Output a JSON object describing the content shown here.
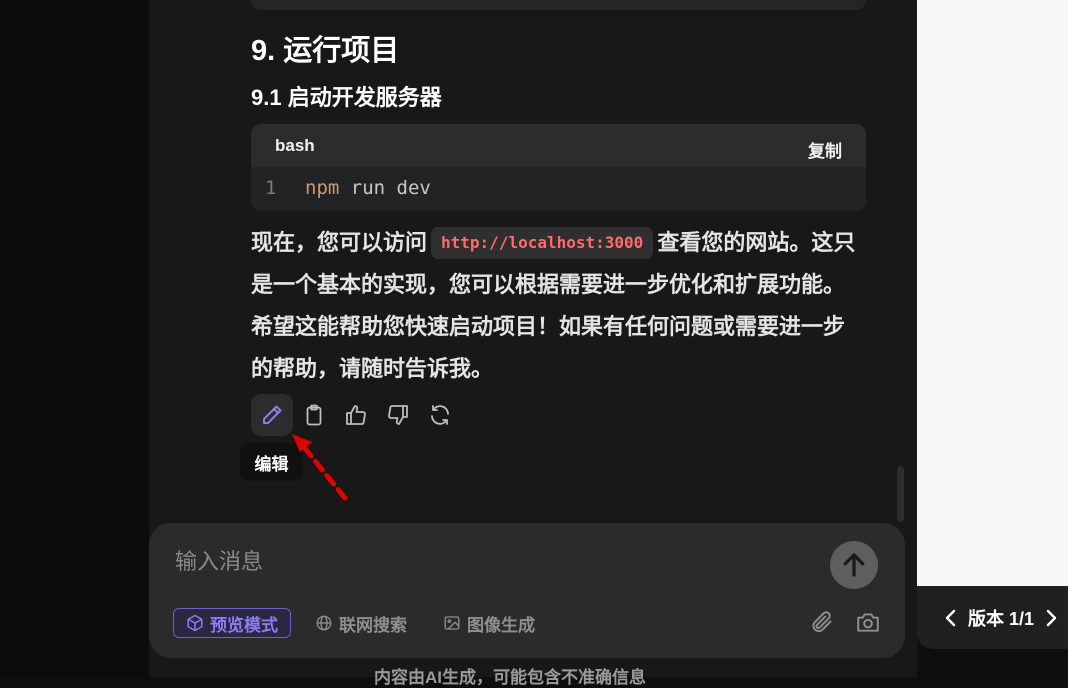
{
  "message": {
    "section_title": "9. 运行项目",
    "subsection_title": "9.1 启动开发服务器",
    "code_block": {
      "language": "bash",
      "copy_label": "复制",
      "line_number": "1",
      "code_cmd": "npm",
      "code_rest": " run dev"
    },
    "para_before": "现在，您可以访问",
    "inline_code": "http://localhost:3000",
    "para_after": "查看您的网站。这只是一个基本的实现，您可以根据需要进一步优化和扩展功能。希望这能帮助您快速启动项目！如果有任何问题或需要进一步的帮助，请随时告诉我。"
  },
  "actions": {
    "icons": [
      "pencil-icon",
      "clipboard-icon",
      "thumbs-up-icon",
      "thumbs-down-icon",
      "refresh-icon"
    ],
    "tooltip": "编辑"
  },
  "composer": {
    "placeholder": "输入消息",
    "tools": [
      {
        "label": "预览模式",
        "icon": "cube-icon",
        "active": true
      },
      {
        "label": "联网搜索",
        "icon": "globe-icon",
        "active": false
      },
      {
        "label": "图像生成",
        "icon": "image-icon",
        "active": false
      }
    ],
    "right_icons": [
      "paperclip-icon",
      "camera-icon"
    ],
    "send_icon": "arrow-up-icon"
  },
  "footer": {
    "note": "内容由AI生成，可能包含不准确信息"
  },
  "version": {
    "label": "版本 1/1"
  },
  "colors": {
    "accent": "#8a7cf3",
    "inline_code_text": "#ff6b6b",
    "annotation_arrow": "#e00000"
  }
}
